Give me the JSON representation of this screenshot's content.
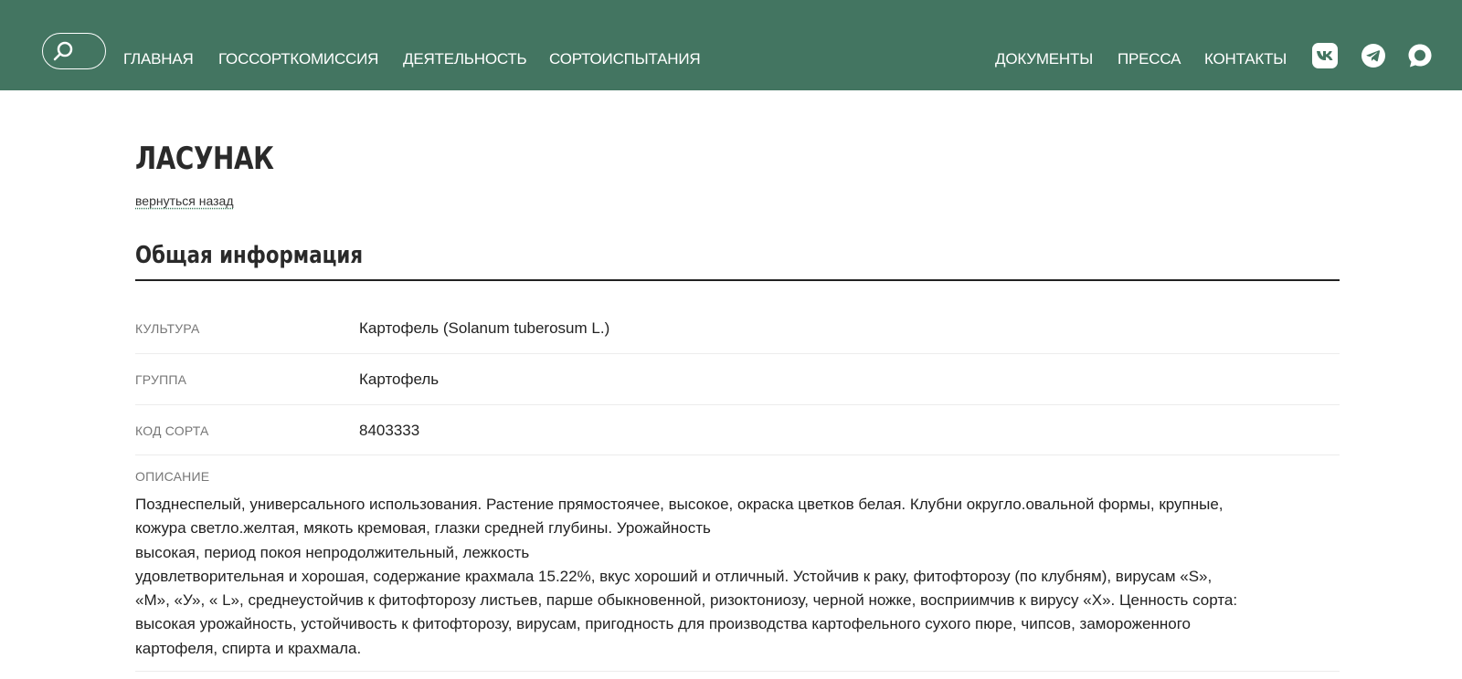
{
  "header": {
    "nav_left": [
      "ГЛАВНАЯ",
      "ГОССОРТКОМИССИЯ",
      "ДЕЯТЕЛЬНОСТЬ",
      "СОРТОИСПЫТАНИЯ"
    ],
    "nav_right": [
      "ДОКУМЕНТЫ",
      "ПРЕССА",
      "КОНТАКТЫ"
    ],
    "social_icons": [
      "vk-icon",
      "telegram-icon",
      "max-messenger-icon"
    ],
    "bar_color": "#437561"
  },
  "page": {
    "title": "ЛАСУНАК",
    "back_link": "вернуться назад",
    "section_title": "Общая информация"
  },
  "info_rows": [
    {
      "label": "КУЛЬТУРА",
      "value": "Картофель (Solanum tuberosum L.)"
    },
    {
      "label": "ГРУППА",
      "value": "Картофель"
    },
    {
      "label": "КОД СОРТА",
      "value": "8403333"
    }
  ],
  "description": {
    "label": "ОПИСАНИЕ",
    "text": "Позднеспелый, универсального использования. Растение прямостоячее, высокое, окраска цветков белая. Клубни округло.овальной формы, крупные,\nкожура светло.желтая, мякоть кремовая, глазки средней глубины. Урожайность\nвысокая, период покоя непродолжительный, лежкость\nудовлетворительная и хорошая, содержание крахмала 15.22%, вкус хороший и отличный. Устойчив к раку, фитофторозу (по клубням), вирусам «S»,\n«M», «У», « L», среднеустойчив к фитофторозу листьев, парше обыкновенной, ризоктониозу, черной ножке, восприимчив к вирусу «X». Ценность сорта:\nвысокая урожайность, устойчивость к фитофторозу, вирусам, пригодность для производства картофельного сухого пюре, чипсов, замороженного\nкартофеля, спирта и крахмала."
  }
}
